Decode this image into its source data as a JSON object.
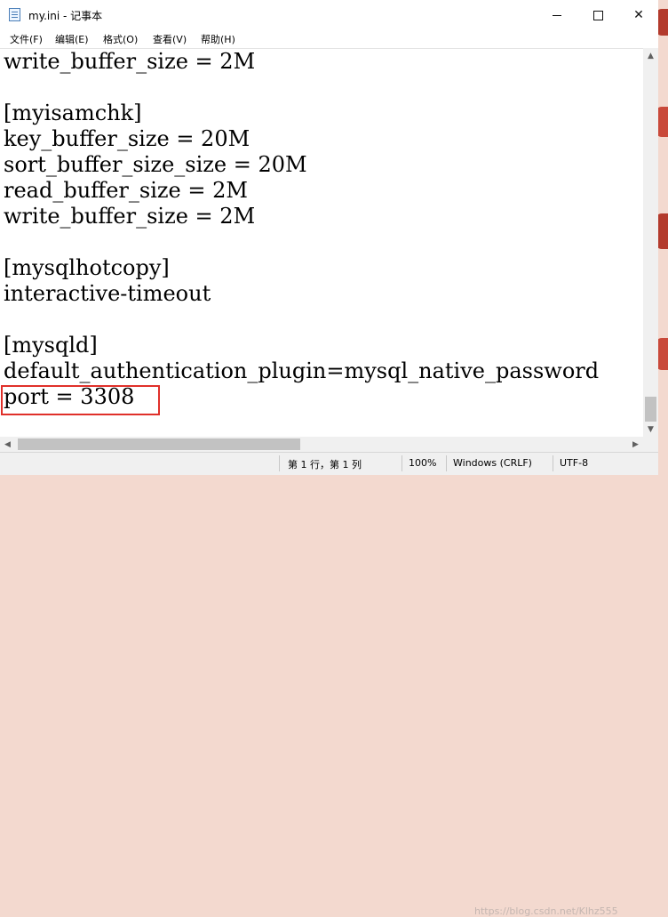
{
  "window": {
    "title": "my.ini - 记事本",
    "app_icon": "notepad-icon",
    "controls": {
      "minimize": "minimize-icon",
      "maximize": "maximize-icon",
      "close": "✕"
    }
  },
  "menu": [
    {
      "label": "文件(F)"
    },
    {
      "label": "编辑(E)"
    },
    {
      "label": "格式(O)"
    },
    {
      "label": "查看(V)"
    },
    {
      "label": "帮助(H)"
    }
  ],
  "editor": {
    "lines": [
      "write_buffer_size = 2M",
      "",
      "[myisamchk]",
      "key_buffer_size = 20M",
      "sort_buffer_size_size = 20M",
      "read_buffer_size = 2M",
      "write_buffer_size = 2M",
      "",
      "[mysqlhotcopy]",
      "interactive-timeout",
      "",
      "[mysqld]",
      "default_authentication_plugin=mysql_native_password",
      "port = 3308"
    ],
    "highlight_color": "#e0302a"
  },
  "status": {
    "position": "第 1 行，第 1 列",
    "zoom": "100%",
    "line_ending": "Windows (CRLF)",
    "encoding": "UTF-8"
  },
  "watermark": "https://blog.csdn.net/Klhz555"
}
